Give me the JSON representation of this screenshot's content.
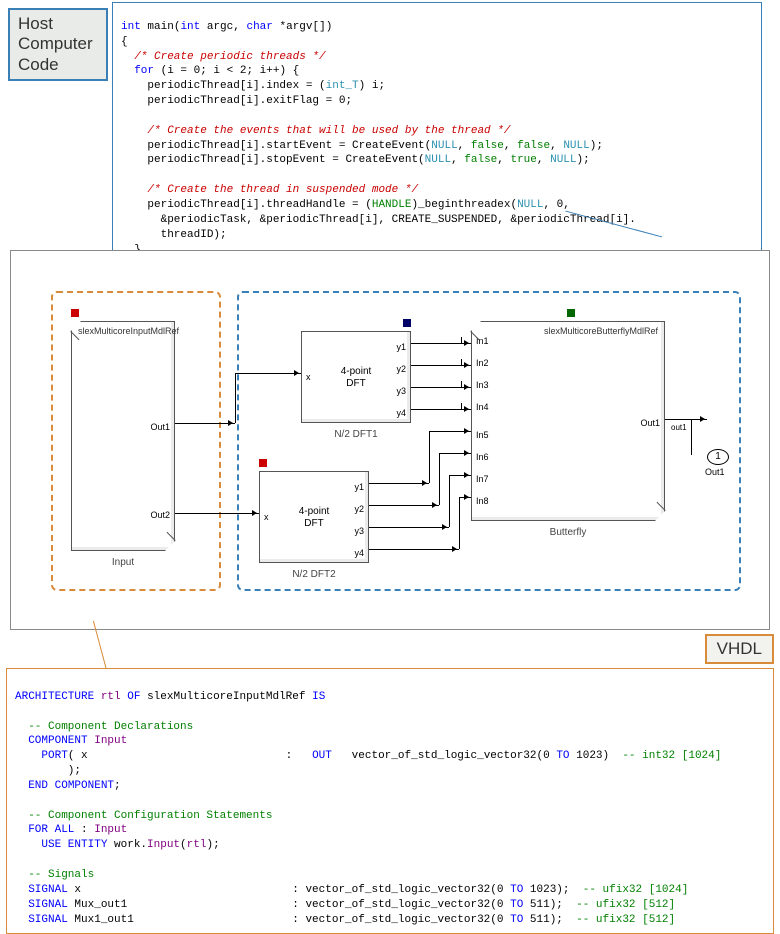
{
  "labels": {
    "host_computer_code": "Host\nComputer\nCode",
    "vhdl": "VHDL"
  },
  "host_code": {
    "sig": {
      "ret": "int",
      "name": "main",
      "args_a": "int",
      "args_b": "argc,",
      "args_c": "char",
      "args_d": "*argv[])"
    },
    "c_comment1": "/* Create periodic threads */",
    "c_for": {
      "kw": "for",
      "body": "(i = 0; i < 2; i++) {"
    },
    "c_l1a": "periodicThread[i].index = (",
    "c_l1b": "int_T",
    "c_l1c": ") i;",
    "c_l2": "periodicThread[i].exitFlag = 0;",
    "c_comment2": "/* Create the events that will be used by the thread */",
    "c_l3a": "periodicThread[i].startEvent = CreateEvent(",
    "c_l3b": "NULL",
    "c_l3c": ", ",
    "c_false": "false",
    "c_true": "true",
    "c_l3end": ");",
    "c_l4a": "periodicThread[i].stopEvent = CreateEvent(",
    "c_comment3": "/* Create the thread in suspended mode */",
    "c_l5a": "periodicThread[i].threadHandle = (",
    "c_l5b": "HANDLE",
    "c_l5c": ")_beginthreadex(",
    "c_l5d": "NULL",
    "c_l5e": ", 0,",
    "c_l6": "&periodicTask, &periodicThread[i], CREATE_SUSPENDED, &periodicThread[i].",
    "c_l7": "threadID);"
  },
  "diagram": {
    "input_block": {
      "title": "slexMulticoreInputMdlRef",
      "out1": "Out1",
      "out2": "Out2",
      "caption": "Input"
    },
    "dft": {
      "x": "x",
      "y1": "y1",
      "y2": "y2",
      "y3": "y3",
      "y4": "y4",
      "center": "4-point\nDFT"
    },
    "dft1_caption": "N/2 DFT1",
    "dft2_caption": "N/2 DFT2",
    "butterfly": {
      "title": "slexMulticoreButterflyMdlRef",
      "in1": "In1",
      "in2": "In2",
      "in3": "In3",
      "in4": "In4",
      "in5": "In5",
      "in6": "In6",
      "in7": "In7",
      "in8": "In8",
      "out": "Out1",
      "caption": "Butterfly"
    },
    "outport": {
      "num": "1",
      "name": "Out1",
      "sig": "out1"
    }
  },
  "vhdl_code": {
    "l1a": "ARCHITECTURE",
    "l1b": "rtl",
    "l1c": "OF",
    "l1d": "slexMulticoreInputMdlRef",
    "l1e": "IS",
    "c1": "-- Component Declarations",
    "l2a": "COMPONENT",
    "l2b": "Input",
    "l3a": "PORT",
    "l3b": "( x                              :   ",
    "l3c": "OUT",
    "l3d": "   vector_of_std_logic_vector32(0 ",
    "l3e": "TO",
    "l3f": " 1023)  ",
    "l3g": "-- int32 [1024]",
    "l4": "        );",
    "l5a": "END",
    "l5b": "COMPONENT",
    "l5c": ";",
    "c2": "-- Component Configuration Statements",
    "l6a": "FOR ALL",
    "l6b": " : ",
    "l6c": "Input",
    "l7a": "USE ENTITY",
    "l7b": " work.",
    "l7c": "Input",
    "l7d": "(",
    "l7e": "rtl",
    "l7f": ");",
    "c3": "-- Signals",
    "l8a": "SIGNAL",
    "l8b": " x                                : vector_of_std_logic_vector32(0 ",
    "l8c": "TO",
    "l8d": " 1023);  ",
    "l8e": "-- ufix32 [1024]",
    "l9a": "SIGNAL",
    "l9b": " Mux_out1                         : vector_of_std_logic_vector32(0 ",
    "l9c": "TO",
    "l9d": " 511);  ",
    "l9e": "-- ufix32 [512]",
    "l10a": "SIGNAL",
    "l10b": " Mux1_out1                        : vector_of_std_logic_vector32(0 ",
    "l10c": "TO",
    "l10d": " 511);  ",
    "l10e": "-- ufix32 [512]"
  }
}
